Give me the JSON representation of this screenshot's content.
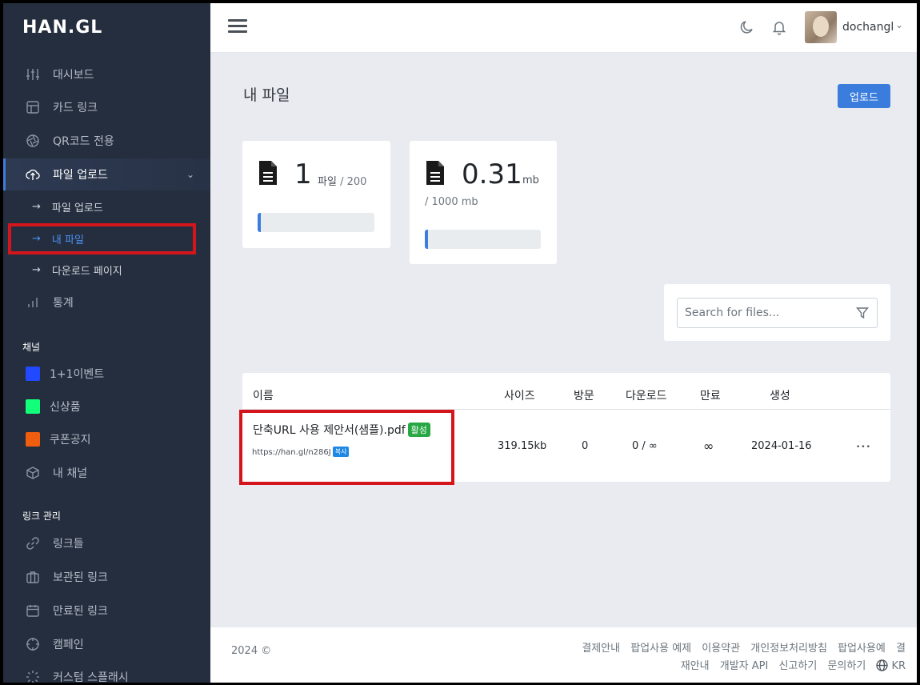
{
  "brand": {
    "logo": "HAN.GL"
  },
  "sidebar": {
    "items": [
      {
        "label": "대시보드",
        "icon": "sliders-icon"
      },
      {
        "label": "카드 링크",
        "icon": "layout-icon"
      },
      {
        "label": "QR코드 전용",
        "icon": "aperture-icon"
      },
      {
        "label": "파일 업로드",
        "icon": "upload-cloud-icon"
      }
    ],
    "sub_items": [
      {
        "label": "파일 업로드"
      },
      {
        "label": "내 파일"
      },
      {
        "label": "다운로드 페이지"
      }
    ],
    "stats_label": "통계",
    "channels_title": "채널",
    "channels": [
      {
        "label": "1+1이벤트",
        "color": "#2149ff"
      },
      {
        "label": "신상품",
        "color": "#12ff7a"
      },
      {
        "label": "쿠폰공지",
        "color": "#ef5d0f"
      },
      {
        "label": "내 채널"
      }
    ],
    "links_title": "링크 관리",
    "links": [
      {
        "label": "링크들"
      },
      {
        "label": "보관된 링크"
      },
      {
        "label": "만료된 링크"
      },
      {
        "label": "캠페인"
      },
      {
        "label": "커스텀 스플래시"
      }
    ],
    "arrow": "→",
    "chevron": "⌄"
  },
  "header": {
    "username": "dochangl",
    "chevron": "⌄"
  },
  "main": {
    "title": "내 파일",
    "upload_label": "업로드",
    "files_stat": {
      "value": "1",
      "unit": "파일",
      "limit": "/ 200",
      "fill": 0.005
    },
    "size_stat": {
      "value": "0.31",
      "unit": "mb",
      "limit": "/ 1000 mb",
      "fill": 0.0003
    },
    "search": {
      "placeholder": "Search for files..."
    },
    "table": {
      "headers": {
        "name": "이름",
        "size": "사이즈",
        "visits": "방문",
        "downloads": "다운로드",
        "expiry": "만료",
        "created": "생성"
      },
      "rows": [
        {
          "name": "단축URL 사용 제안서(샘플).pdf",
          "status": "활성",
          "url": "https://han.gl/n286J",
          "copy_label": "복사",
          "size": "319.15kb",
          "visits": "0",
          "downloads": "0 / ∞",
          "expiry": "∞",
          "created": "2024-01-16",
          "more": "•••"
        }
      ]
    }
  },
  "footer": {
    "copyright": "2024 ©",
    "links": [
      "결제안내",
      "팝업사용 예제",
      "이용약관",
      "개인정보처리방침",
      "팝업사용예",
      "결재안내",
      "개발자 API",
      "신고하기",
      "문의하기"
    ],
    "language": "KR"
  }
}
